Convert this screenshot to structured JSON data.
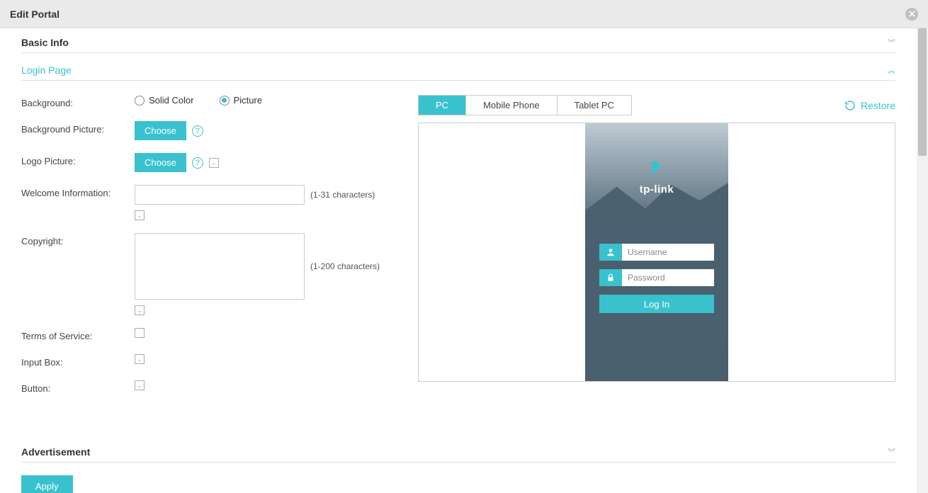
{
  "modal": {
    "title": "Edit Portal"
  },
  "sections": {
    "basic": "Basic Info",
    "login": "Login Page",
    "adv": "Advertisement"
  },
  "form": {
    "background_label": "Background:",
    "bg_solid": "Solid Color",
    "bg_picture": "Picture",
    "bg_picture_label": "Background Picture:",
    "logo_picture_label": "Logo Picture:",
    "choose": "Choose",
    "welcome_label": "Welcome Information:",
    "welcome_hint": "(1-31 characters)",
    "copyright_label": "Copyright:",
    "copyright_hint": "(1-200 characters)",
    "tos_label": "Terms of Service:",
    "input_box_label": "Input Box:",
    "button_label": "Button:"
  },
  "preview": {
    "tabs": {
      "pc": "PC",
      "mobile": "Mobile Phone",
      "tablet": "Tablet PC"
    },
    "restore": "Restore",
    "logo_text": "tp-link",
    "username_ph": "Username",
    "password_ph": "Password",
    "login_btn": "Log In"
  },
  "footer": {
    "apply": "Apply"
  },
  "colors": {
    "accent": "#39c2cd"
  }
}
